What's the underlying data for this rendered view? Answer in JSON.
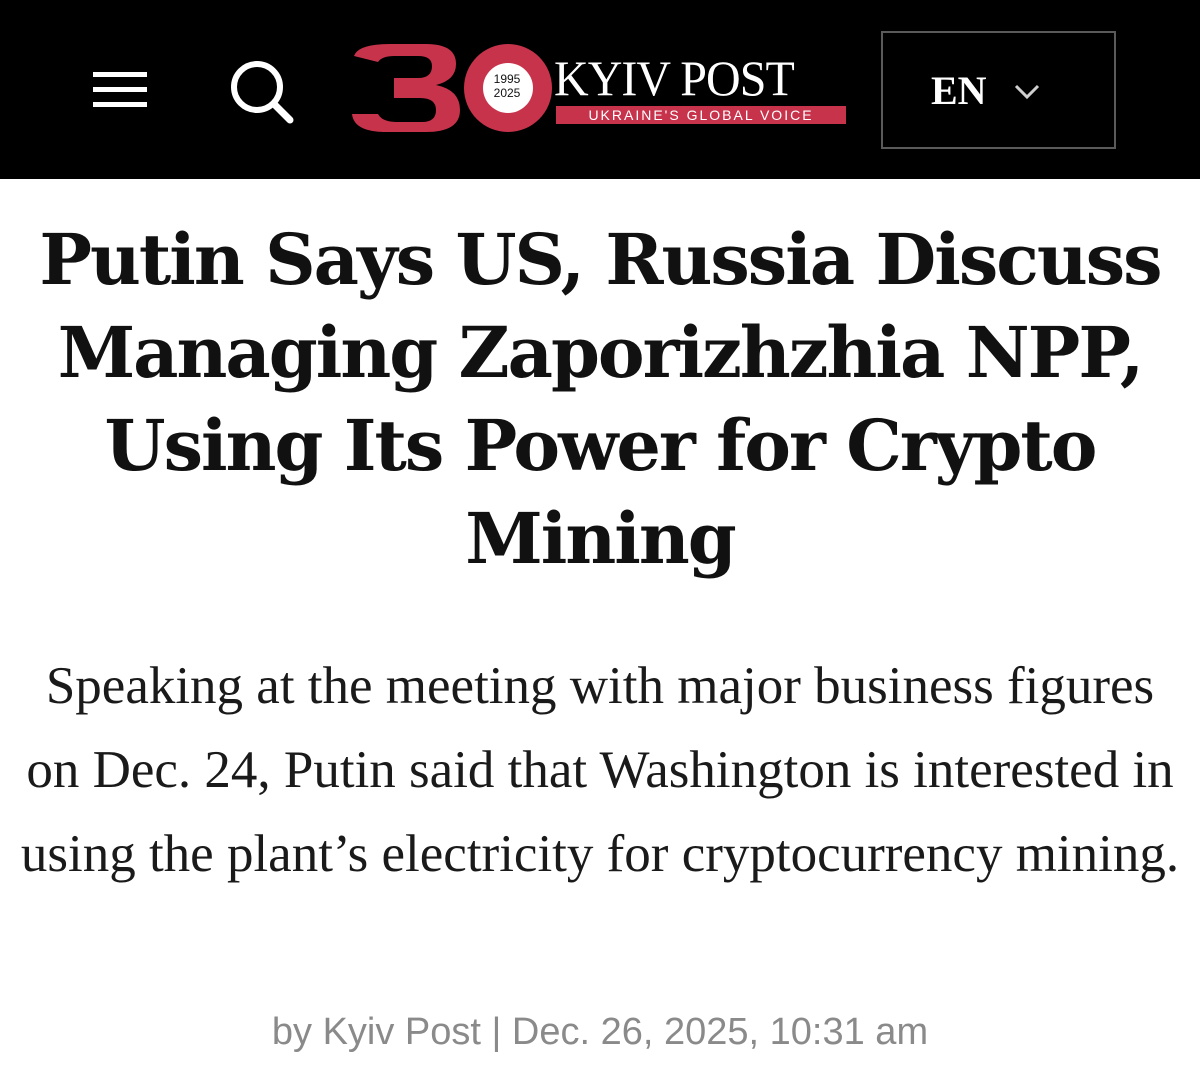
{
  "header": {
    "menu_icon": "hamburger-menu-icon",
    "search_icon": "search-icon",
    "logo": {
      "number": "30",
      "year_start": "1995",
      "year_end": "2025",
      "brand": "KYIV POST",
      "tagline": "UKRAINE'S GLOBAL VOICE"
    },
    "language": {
      "selected": "EN",
      "icon": "chevron-down-icon"
    }
  },
  "article": {
    "headline": "Putin Says US, Russia Discuss Managing Zaporizhzhia NPP, Using Its Power for Crypto Mining",
    "dek": "Speaking at the meeting with major business figures on Dec. 24, Putin said that Washington is interested in using the plant’s electricity for cryptocurrency mining.",
    "byline": "by Kyiv Post | Dec. 26, 2025, 10:31 am"
  },
  "colors": {
    "header_bg": "#000000",
    "accent": "#c8334c",
    "headline_text": "#111111",
    "byline_text": "#8a8a8a"
  }
}
